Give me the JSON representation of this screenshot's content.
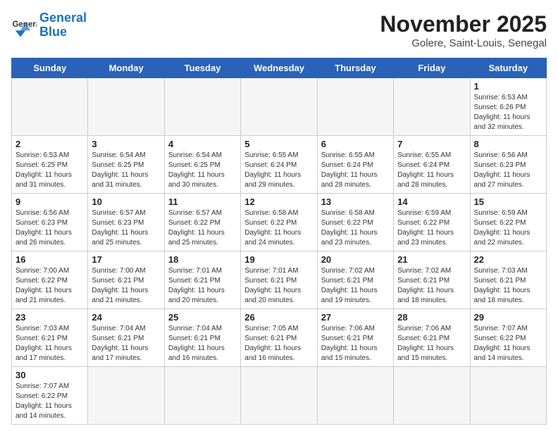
{
  "header": {
    "logo_general": "General",
    "logo_blue": "Blue",
    "month": "November 2025",
    "location": "Golere, Saint-Louis, Senegal"
  },
  "days_of_week": [
    "Sunday",
    "Monday",
    "Tuesday",
    "Wednesday",
    "Thursday",
    "Friday",
    "Saturday"
  ],
  "weeks": [
    [
      {
        "day": "",
        "info": ""
      },
      {
        "day": "",
        "info": ""
      },
      {
        "day": "",
        "info": ""
      },
      {
        "day": "",
        "info": ""
      },
      {
        "day": "",
        "info": ""
      },
      {
        "day": "",
        "info": ""
      },
      {
        "day": "1",
        "info": "Sunrise: 6:53 AM\nSunset: 6:26 PM\nDaylight: 11 hours and 32 minutes."
      }
    ],
    [
      {
        "day": "2",
        "info": "Sunrise: 6:53 AM\nSunset: 6:25 PM\nDaylight: 11 hours and 31 minutes."
      },
      {
        "day": "3",
        "info": "Sunrise: 6:54 AM\nSunset: 6:25 PM\nDaylight: 11 hours and 31 minutes."
      },
      {
        "day": "4",
        "info": "Sunrise: 6:54 AM\nSunset: 6:25 PM\nDaylight: 11 hours and 30 minutes."
      },
      {
        "day": "5",
        "info": "Sunrise: 6:55 AM\nSunset: 6:24 PM\nDaylight: 11 hours and 29 minutes."
      },
      {
        "day": "6",
        "info": "Sunrise: 6:55 AM\nSunset: 6:24 PM\nDaylight: 11 hours and 28 minutes."
      },
      {
        "day": "7",
        "info": "Sunrise: 6:55 AM\nSunset: 6:24 PM\nDaylight: 11 hours and 28 minutes."
      },
      {
        "day": "8",
        "info": "Sunrise: 6:56 AM\nSunset: 6:23 PM\nDaylight: 11 hours and 27 minutes."
      }
    ],
    [
      {
        "day": "9",
        "info": "Sunrise: 6:56 AM\nSunset: 6:23 PM\nDaylight: 11 hours and 26 minutes."
      },
      {
        "day": "10",
        "info": "Sunrise: 6:57 AM\nSunset: 6:23 PM\nDaylight: 11 hours and 25 minutes."
      },
      {
        "day": "11",
        "info": "Sunrise: 6:57 AM\nSunset: 6:22 PM\nDaylight: 11 hours and 25 minutes."
      },
      {
        "day": "12",
        "info": "Sunrise: 6:58 AM\nSunset: 6:22 PM\nDaylight: 11 hours and 24 minutes."
      },
      {
        "day": "13",
        "info": "Sunrise: 6:58 AM\nSunset: 6:22 PM\nDaylight: 11 hours and 23 minutes."
      },
      {
        "day": "14",
        "info": "Sunrise: 6:59 AM\nSunset: 6:22 PM\nDaylight: 11 hours and 23 minutes."
      },
      {
        "day": "15",
        "info": "Sunrise: 6:59 AM\nSunset: 6:22 PM\nDaylight: 11 hours and 22 minutes."
      }
    ],
    [
      {
        "day": "16",
        "info": "Sunrise: 7:00 AM\nSunset: 6:22 PM\nDaylight: 11 hours and 21 minutes."
      },
      {
        "day": "17",
        "info": "Sunrise: 7:00 AM\nSunset: 6:21 PM\nDaylight: 11 hours and 21 minutes."
      },
      {
        "day": "18",
        "info": "Sunrise: 7:01 AM\nSunset: 6:21 PM\nDaylight: 11 hours and 20 minutes."
      },
      {
        "day": "19",
        "info": "Sunrise: 7:01 AM\nSunset: 6:21 PM\nDaylight: 11 hours and 20 minutes."
      },
      {
        "day": "20",
        "info": "Sunrise: 7:02 AM\nSunset: 6:21 PM\nDaylight: 11 hours and 19 minutes."
      },
      {
        "day": "21",
        "info": "Sunrise: 7:02 AM\nSunset: 6:21 PM\nDaylight: 11 hours and 18 minutes."
      },
      {
        "day": "22",
        "info": "Sunrise: 7:03 AM\nSunset: 6:21 PM\nDaylight: 11 hours and 18 minutes."
      }
    ],
    [
      {
        "day": "23",
        "info": "Sunrise: 7:03 AM\nSunset: 6:21 PM\nDaylight: 11 hours and 17 minutes."
      },
      {
        "day": "24",
        "info": "Sunrise: 7:04 AM\nSunset: 6:21 PM\nDaylight: 11 hours and 17 minutes."
      },
      {
        "day": "25",
        "info": "Sunrise: 7:04 AM\nSunset: 6:21 PM\nDaylight: 11 hours and 16 minutes."
      },
      {
        "day": "26",
        "info": "Sunrise: 7:05 AM\nSunset: 6:21 PM\nDaylight: 11 hours and 16 minutes."
      },
      {
        "day": "27",
        "info": "Sunrise: 7:06 AM\nSunset: 6:21 PM\nDaylight: 11 hours and 15 minutes."
      },
      {
        "day": "28",
        "info": "Sunrise: 7:06 AM\nSunset: 6:21 PM\nDaylight: 11 hours and 15 minutes."
      },
      {
        "day": "29",
        "info": "Sunrise: 7:07 AM\nSunset: 6:22 PM\nDaylight: 11 hours and 14 minutes."
      }
    ],
    [
      {
        "day": "30",
        "info": "Sunrise: 7:07 AM\nSunset: 6:22 PM\nDaylight: 11 hours and 14 minutes."
      },
      {
        "day": "",
        "info": ""
      },
      {
        "day": "",
        "info": ""
      },
      {
        "day": "",
        "info": ""
      },
      {
        "day": "",
        "info": ""
      },
      {
        "day": "",
        "info": ""
      },
      {
        "day": "",
        "info": ""
      }
    ]
  ]
}
